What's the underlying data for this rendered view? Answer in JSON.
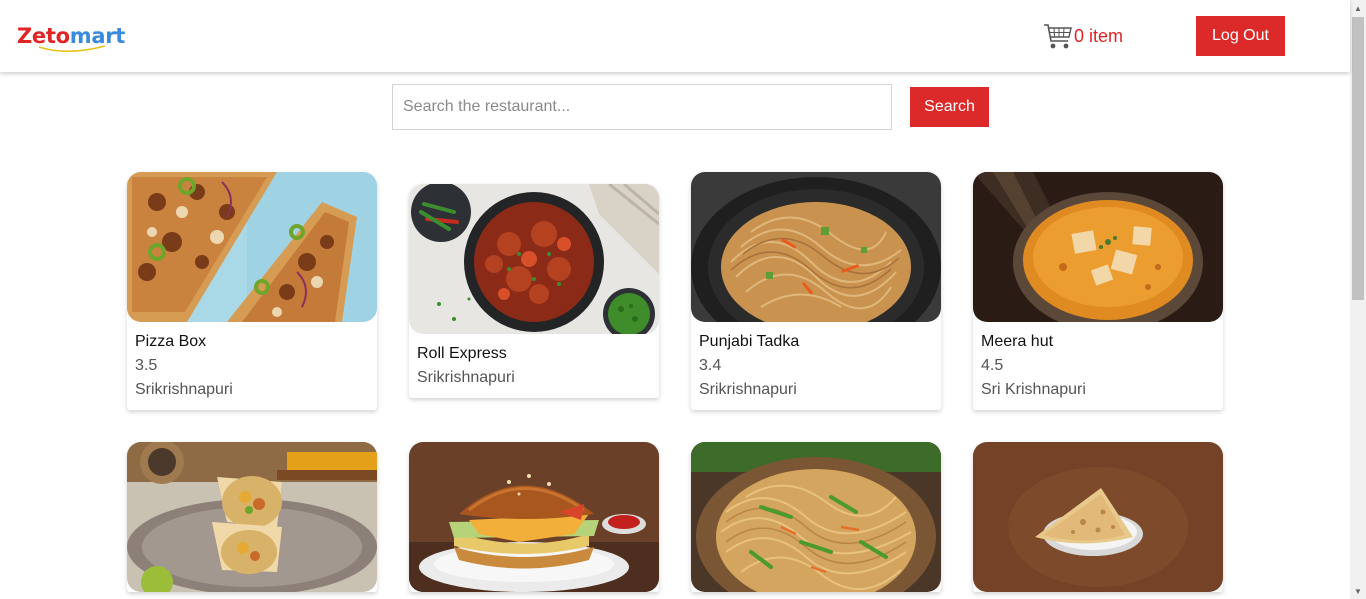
{
  "header": {
    "logo_part1": "Zeto",
    "logo_part2": "mart",
    "cart_label": "0 item",
    "logout_label": "Log Out"
  },
  "search": {
    "placeholder": "Search the restaurant...",
    "value": "",
    "button_label": "Search"
  },
  "restaurants": [
    {
      "name": "Pizza Box",
      "rating": "3.5",
      "area": "Srikrishnapuri",
      "image": "pizza"
    },
    {
      "name": "Roll Express",
      "rating": "",
      "area": "Srikrishnapuri",
      "image": "chilli-chicken"
    },
    {
      "name": "Punjabi Tadka",
      "rating": "3.4",
      "area": "Srikrishnapuri",
      "image": "noodles"
    },
    {
      "name": "Meera hut",
      "rating": "4.5",
      "area": "Sri Krishnapuri",
      "image": "paneer-curry"
    },
    {
      "name": "",
      "rating": "",
      "area": "",
      "image": "wrap-roll"
    },
    {
      "name": "",
      "rating": "",
      "area": "",
      "image": "burger"
    },
    {
      "name": "",
      "rating": "",
      "area": "",
      "image": "hakka-noodles"
    },
    {
      "name": "",
      "rating": "",
      "area": "",
      "image": "paratha"
    }
  ],
  "colors": {
    "brand_red": "#dc2a2a",
    "logo_blue": "#3a8be0"
  },
  "icons": [
    "cart-icon"
  ]
}
